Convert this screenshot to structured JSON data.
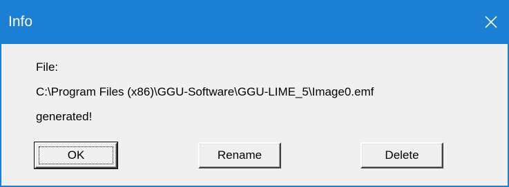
{
  "window": {
    "title": "Info",
    "close_icon": "close-icon",
    "titlebar_color": "#1b80d4"
  },
  "message": {
    "line1": "File:",
    "line2": "C:\\Program Files (x86)\\GGU-Software\\GGU-LIME_5\\Image0.emf",
    "line3": "generated!"
  },
  "buttons": {
    "ok": "OK",
    "rename": "Rename",
    "delete": "Delete"
  }
}
